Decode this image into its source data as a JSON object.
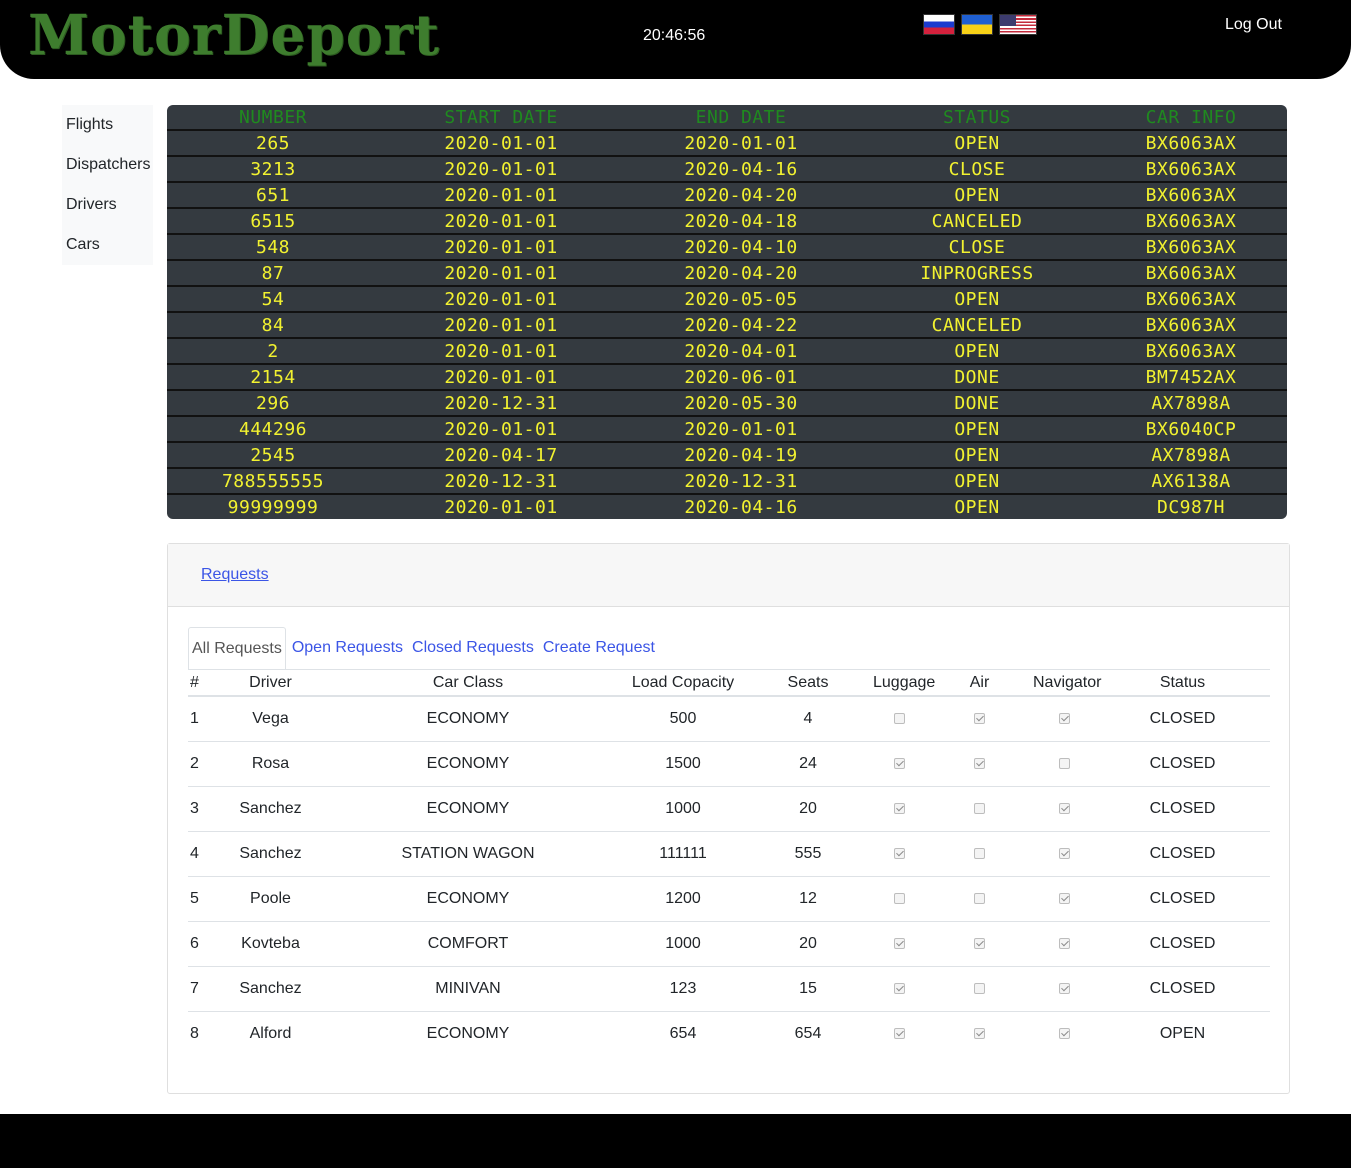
{
  "header": {
    "logo": "MotorDeport",
    "clock": "20:46:56",
    "flags": [
      "russian-flag-icon",
      "ukrainian-flag-icon",
      "us-flag-icon"
    ],
    "logout_label": "Log Out"
  },
  "sidebar": {
    "items": [
      {
        "label": "Flights"
      },
      {
        "label": "Dispatchers"
      },
      {
        "label": "Drivers"
      },
      {
        "label": "Cars"
      }
    ]
  },
  "flights_board": {
    "columns": [
      "NUMBER",
      "START DATE",
      "END DATE",
      "STATUS",
      "CAR INFO"
    ],
    "rows": [
      [
        "265",
        "2020-01-01",
        "2020-01-01",
        "OPEN",
        "BX6063AX"
      ],
      [
        "3213",
        "2020-01-01",
        "2020-04-16",
        "CLOSE",
        "BX6063AX"
      ],
      [
        "651",
        "2020-01-01",
        "2020-04-20",
        "OPEN",
        "BX6063AX"
      ],
      [
        "6515",
        "2020-01-01",
        "2020-04-18",
        "CANCELED",
        "BX6063AX"
      ],
      [
        "548",
        "2020-01-01",
        "2020-04-10",
        "CLOSE",
        "BX6063AX"
      ],
      [
        "87",
        "2020-01-01",
        "2020-04-20",
        "INPROGRESS",
        "BX6063AX"
      ],
      [
        "54",
        "2020-01-01",
        "2020-05-05",
        "OPEN",
        "BX6063AX"
      ],
      [
        "84",
        "2020-01-01",
        "2020-04-22",
        "CANCELED",
        "BX6063AX"
      ],
      [
        "2",
        "2020-01-01",
        "2020-04-01",
        "OPEN",
        "BX6063AX"
      ],
      [
        "2154",
        "2020-01-01",
        "2020-06-01",
        "DONE",
        "BM7452AX"
      ],
      [
        "296",
        "2020-12-31",
        "2020-05-30",
        "DONE",
        "AX7898A"
      ],
      [
        "444296",
        "2020-01-01",
        "2020-01-01",
        "OPEN",
        "BX6040CP"
      ],
      [
        "2545",
        "2020-04-17",
        "2020-04-19",
        "OPEN",
        "AX7898A"
      ],
      [
        "788555555",
        "2020-12-31",
        "2020-12-31",
        "OPEN",
        "AX6138A"
      ],
      [
        "99999999",
        "2020-01-01",
        "2020-04-16",
        "OPEN",
        "DC987H"
      ]
    ]
  },
  "requests": {
    "header_link": "Requests",
    "tabs": [
      {
        "label": "All Requests",
        "active": true
      },
      {
        "label": "Open Requests",
        "active": false
      },
      {
        "label": "Closed Requests",
        "active": false
      },
      {
        "label": "Create Request",
        "active": false
      }
    ],
    "columns": [
      "#",
      "Driver",
      "Car Class",
      "Load Copacity",
      "Seats",
      "Luggage",
      "Air",
      "Navigator",
      "Status"
    ],
    "rows": [
      {
        "n": "1",
        "driver": "Vega",
        "car_class": "ECONOMY",
        "load": "500",
        "seats": "4",
        "luggage": false,
        "air": true,
        "navigator": true,
        "status": "CLOSED"
      },
      {
        "n": "2",
        "driver": "Rosa",
        "car_class": "ECONOMY",
        "load": "1500",
        "seats": "24",
        "luggage": true,
        "air": true,
        "navigator": false,
        "status": "CLOSED"
      },
      {
        "n": "3",
        "driver": "Sanchez",
        "car_class": "ECONOMY",
        "load": "1000",
        "seats": "20",
        "luggage": true,
        "air": false,
        "navigator": true,
        "status": "CLOSED"
      },
      {
        "n": "4",
        "driver": "Sanchez",
        "car_class": "STATION WAGON",
        "load": "111111",
        "seats": "555",
        "luggage": true,
        "air": false,
        "navigator": true,
        "status": "CLOSED"
      },
      {
        "n": "5",
        "driver": "Poole",
        "car_class": "ECONOMY",
        "load": "1200",
        "seats": "12",
        "luggage": false,
        "air": false,
        "navigator": true,
        "status": "CLOSED"
      },
      {
        "n": "6",
        "driver": "Kovteba",
        "car_class": "COMFORT",
        "load": "1000",
        "seats": "20",
        "luggage": true,
        "air": true,
        "navigator": true,
        "status": "CLOSED"
      },
      {
        "n": "7",
        "driver": "Sanchez",
        "car_class": "MINIVAN",
        "load": "123",
        "seats": "15",
        "luggage": true,
        "air": false,
        "navigator": true,
        "status": "CLOSED"
      },
      {
        "n": "8",
        "driver": "Alford",
        "car_class": "ECONOMY",
        "load": "654",
        "seats": "654",
        "luggage": true,
        "air": true,
        "navigator": true,
        "status": "OPEN"
      }
    ]
  },
  "colors": {
    "logo": "#3e7d2e",
    "board_bg": "#343a40",
    "board_header": "#1f8a1f",
    "board_text": "#f2f230",
    "link": "#3b55e6"
  }
}
